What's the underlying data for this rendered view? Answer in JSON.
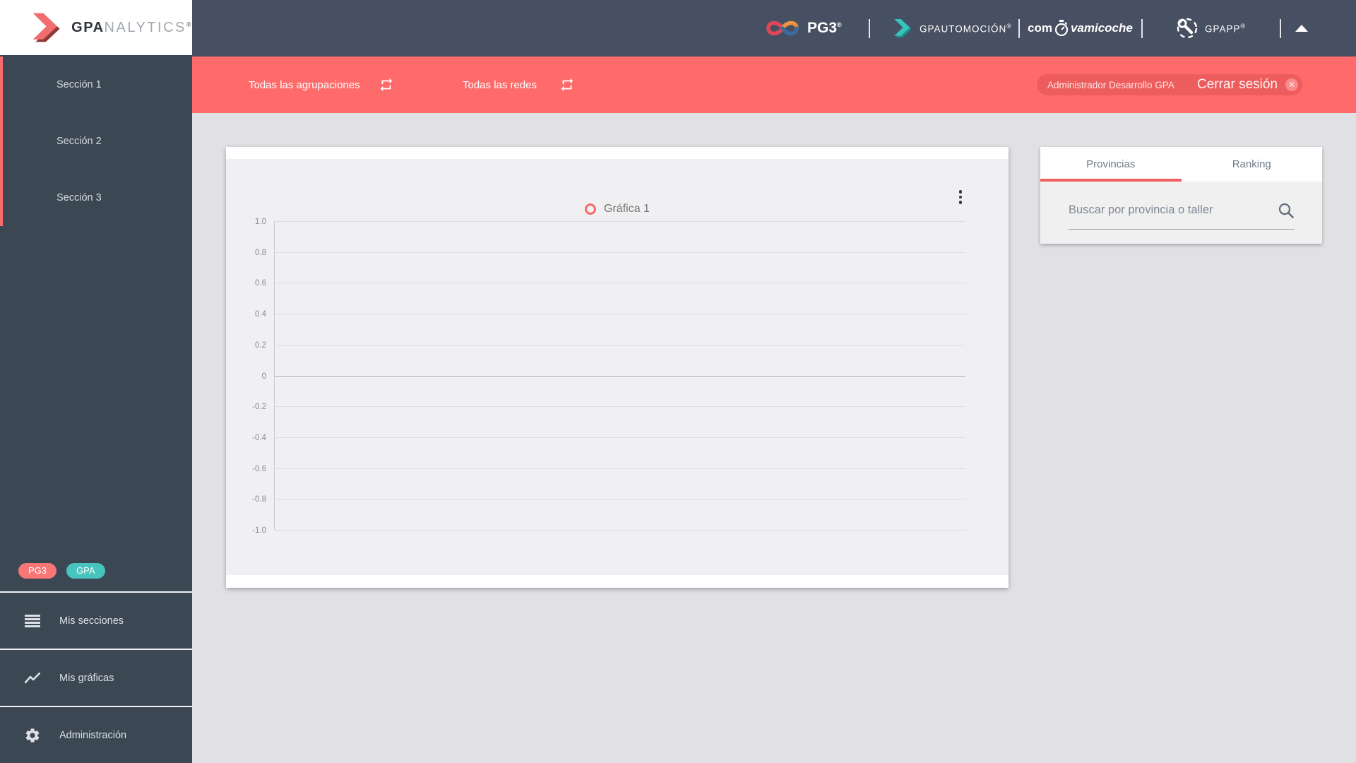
{
  "brand": {
    "name_bold": "GPA",
    "name_rest": "NALYTICS",
    "registered": "®"
  },
  "topbar": {
    "pg3": {
      "label": "PG3",
      "registered": "®"
    },
    "gpautomocion": {
      "label": "GPAUTOMOCIÓN",
      "registered": "®"
    },
    "comovamicoche": {
      "prefix": "com",
      "suffix": "vamicoche"
    },
    "gpapp": {
      "label": "GPAPP",
      "registered": "®"
    }
  },
  "filterbar": {
    "groupings_label": "Todas las agrupaciones",
    "networks_label": "Todas las redes",
    "user_chip": {
      "user_label": "Administrador Desarrollo GPA",
      "logout_label": "Cerrar sesión",
      "close_glyph": "✕"
    }
  },
  "sidebar": {
    "sections": [
      {
        "label": "Sección 1"
      },
      {
        "label": "Sección 2"
      },
      {
        "label": "Sección 3"
      }
    ],
    "badges": [
      {
        "label": "PG3",
        "color": "#f87676"
      },
      {
        "label": "GPA",
        "color": "#47c4bd"
      }
    ],
    "menu": [
      {
        "label": "Mis secciones",
        "icon": "list-icon"
      },
      {
        "label": "Mis gráficas",
        "icon": "line-chart-icon"
      },
      {
        "label": "Administración",
        "icon": "gear-icon"
      }
    ]
  },
  "chart_card": {
    "legend_label": "Gráfica 1"
  },
  "chart_data": {
    "type": "line",
    "title": "Gráfica 1",
    "series": [
      {
        "name": "Gráfica 1",
        "values": []
      }
    ],
    "x": [],
    "ylim": [
      -1,
      1
    ],
    "yticks": [
      "1.0",
      "0.8",
      "0.6",
      "0.4",
      "0.2",
      "0",
      "-0.2",
      "-0.4",
      "-0.6",
      "-0.8",
      "-1.0"
    ],
    "grid": true,
    "legend_position": "top-center",
    "legend_marker_color": "#f56b6b"
  },
  "right_panel": {
    "tabs": [
      {
        "label": "Provincias",
        "active": true
      },
      {
        "label": "Ranking",
        "active": false
      }
    ],
    "search_placeholder": "Buscar por provincia o taller"
  },
  "colors": {
    "accent_red": "#ff6b6b",
    "badge_teal": "#47c4bd",
    "topbar_bg": "#475062",
    "sidebar_bg": "#3c4754",
    "chart_bg": "#f0f0f2",
    "page_bg": "#e1e1e5"
  }
}
